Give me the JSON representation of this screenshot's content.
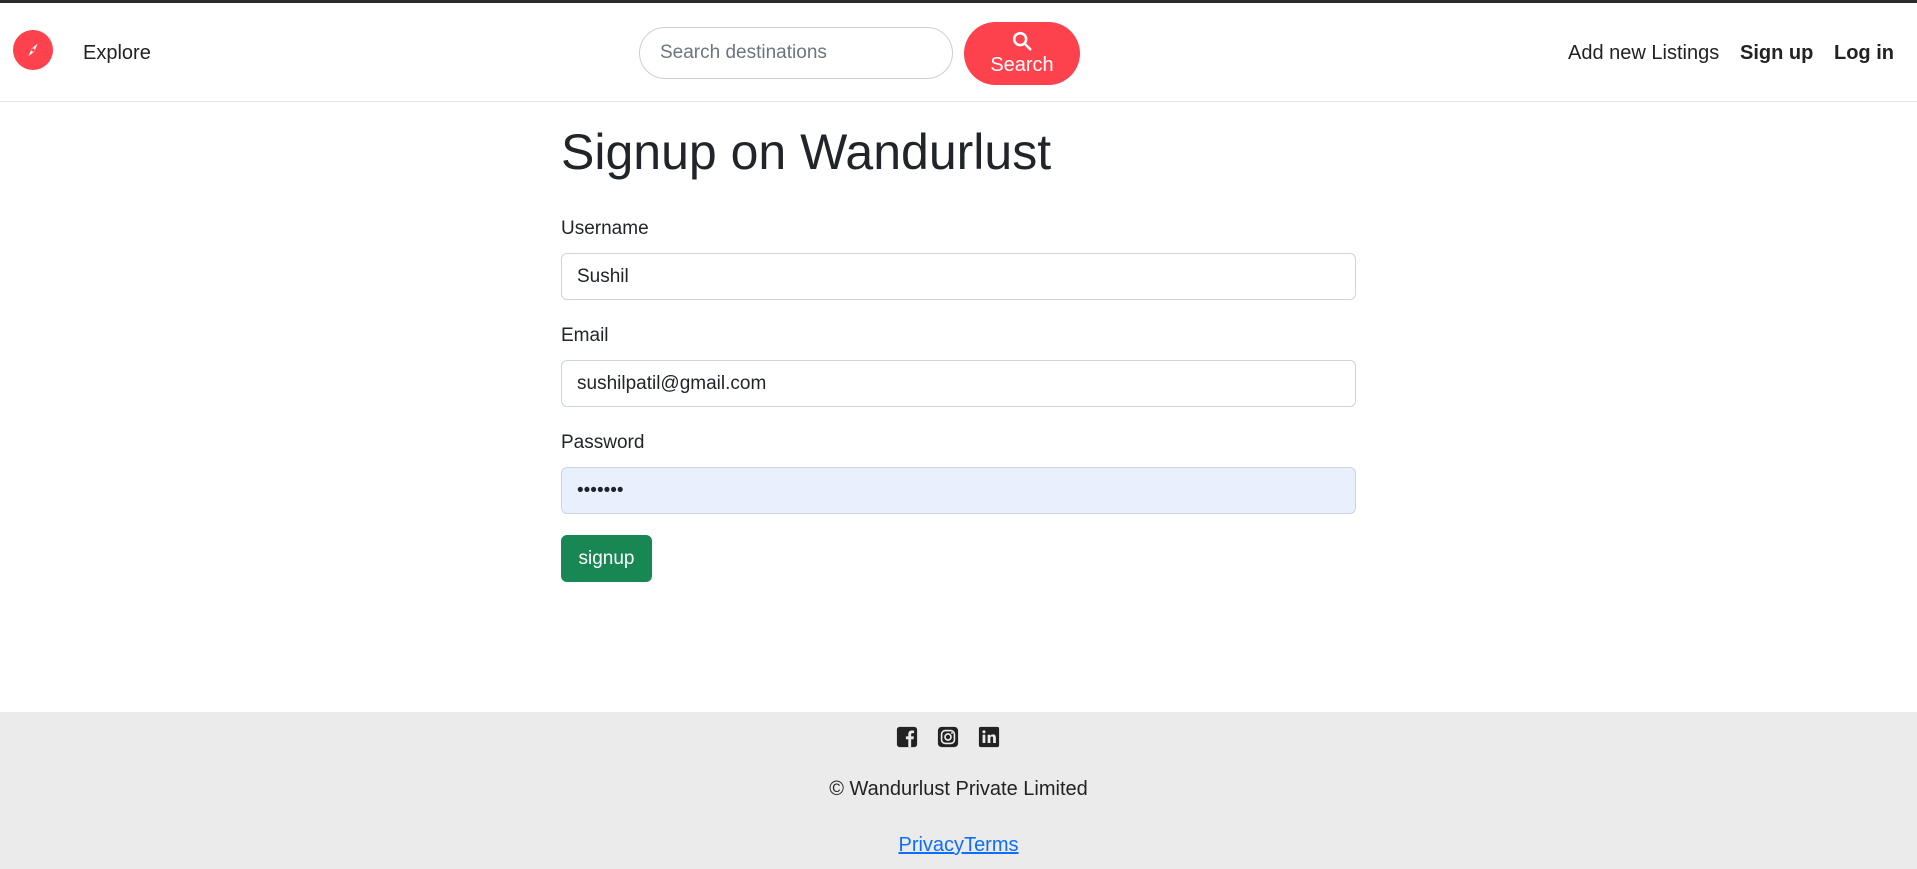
{
  "navbar": {
    "brand_icon": "compass-icon",
    "explore_label": "Explore",
    "search_placeholder": "Search destinations",
    "search_button_label": "Search",
    "add_listing_label": "Add new Listings",
    "signup_label": "Sign up",
    "login_label": "Log in"
  },
  "form": {
    "title": "Signup on Wandurlust",
    "username_label": "Username",
    "username_value": "Sushil",
    "email_label": "Email",
    "email_value": "sushilpatil@gmail.com",
    "password_label": "Password",
    "password_value": "•••••••",
    "submit_label": "signup"
  },
  "footer": {
    "social_icons": [
      "facebook-icon",
      "instagram-icon",
      "linkedin-icon"
    ],
    "copyright": "© Wandurlust Private Limited",
    "privacy_label": "Privacy",
    "terms_label": "Terms"
  },
  "colors": {
    "brand": "#fe424d",
    "submit": "#198754",
    "footer_bg": "#ebebeb",
    "link": "#0d6efd",
    "autofill_bg": "#e8f0fe"
  }
}
